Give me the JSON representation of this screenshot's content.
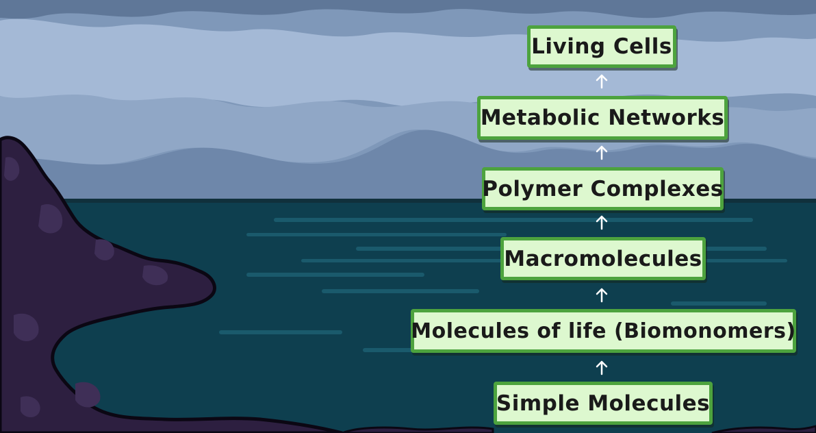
{
  "diagram": {
    "steps": [
      {
        "label": "Living Cells"
      },
      {
        "label": "Metabolic Networks"
      },
      {
        "label": "Polymer Complexes"
      },
      {
        "label": "Macromolecules"
      },
      {
        "label": "Molecules of life (Biomonomers)"
      },
      {
        "label": "Simple Molecules"
      }
    ],
    "arrow_icon": "arrow-up-icon"
  },
  "colors": {
    "box_fill": "#ddf8cf",
    "box_border": "#4da33e",
    "sky": "#8fa6c4",
    "sea": "#0e3f4f",
    "rock": "#2d1f40"
  }
}
